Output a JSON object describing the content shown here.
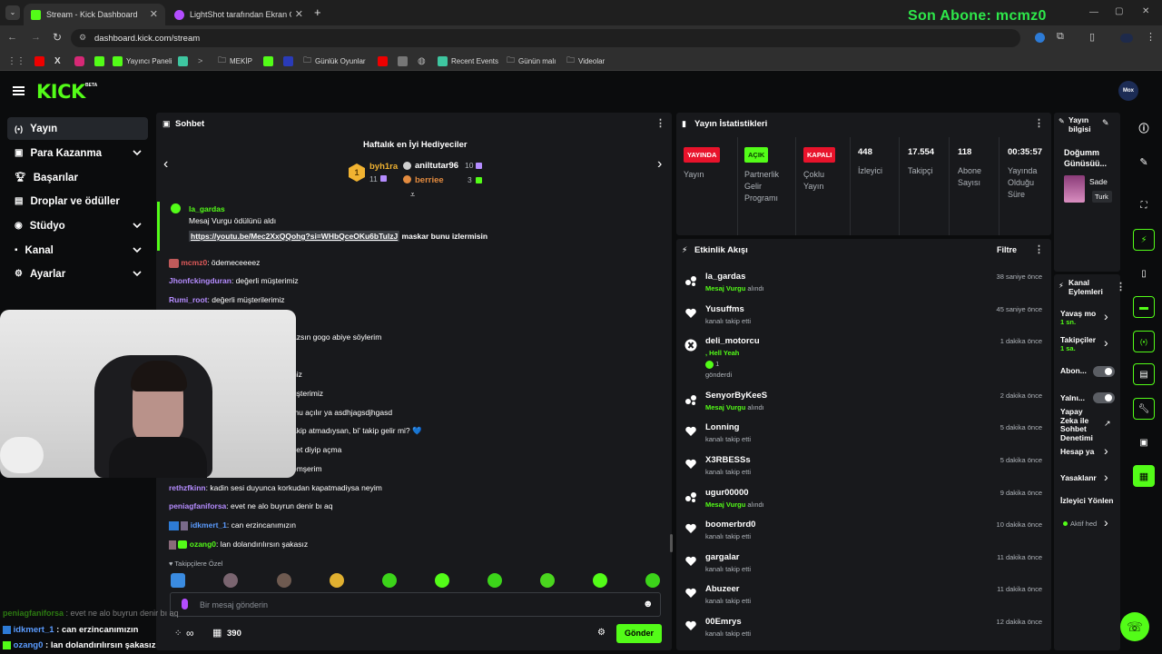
{
  "browser": {
    "tabs": [
      {
        "label": "Stream - Kick Dashboard"
      },
      {
        "label": "LightShot tarafından Ekran Gör"
      }
    ],
    "url": "dashboard.kick.com/stream",
    "bookmarks": [
      "Yayıncı Paneli",
      "MEKİP",
      "Günlük Oyunlar",
      "Recent Events",
      "Günün malı",
      "Videolar"
    ]
  },
  "overlay": {
    "last_sub": "Son Abone: mcmz0"
  },
  "app": {
    "logo": "KICK",
    "logo_tag": "BETA",
    "avatar_text": "Mox"
  },
  "sidebar": {
    "items": [
      {
        "label": "Yayın",
        "icon": "broadcast-icon"
      },
      {
        "label": "Para Kazanma",
        "icon": "wallet-icon"
      },
      {
        "label": "Başarılar",
        "icon": "trophy-icon"
      },
      {
        "label": "Droplar ve ödüller",
        "icon": "gift-icon"
      },
      {
        "label": "Stüdyo",
        "icon": "studio-icon"
      },
      {
        "label": "Kanal",
        "icon": "user-icon"
      },
      {
        "label": "Ayarlar",
        "icon": "gear-icon"
      }
    ]
  },
  "chat": {
    "title": "Sohbet",
    "leaderboard_title": "Haftalık en İyi Hediyeciler",
    "leaders": [
      {
        "rank": "1",
        "name": "byh1ra",
        "count": "11"
      },
      {
        "name": "aniltutar96",
        "count": "10"
      },
      {
        "name": "berriee",
        "count": "3"
      }
    ],
    "highlight": {
      "user": "la_gardas",
      "reward": "Mesaj Vurgu ödülünü aldı",
      "link": "https://youtu.be/Mec2XxQQohg?si=WHbQceOKu6bTulzJ",
      "text": " maskar bunu izlermisin"
    },
    "messages": [
      {
        "user": "mcmz0",
        "text": ": ödemeceeeez",
        "color": "#e05a5a"
      },
      {
        "user": "Jhonfckingduran",
        "text": ": değerli müşterimiz",
        "color": "#b58cff"
      },
      {
        "user": "Rumi_root",
        "text": ": değerli müşterilerimiz",
        "color": "#b58cff"
      },
      {
        "user": "",
        "text": "azsın gogo abiye söylerim",
        "color": "#fff"
      },
      {
        "user": "",
        "text": "niz",
        "color": "#fff"
      },
      {
        "user": "",
        "text": "üşterimiz",
        "color": "#fff"
      },
      {
        "user": "",
        "text": "mu açılır ya asdhjagsdjhgasd",
        "color": "#fff"
      },
      {
        "user": "",
        "text": "akip atmadıysan, bi' takip gelir mi? 💙",
        "color": "#fff"
      },
      {
        "user": "",
        "text": "vet diyip açma",
        "color": "#fff"
      },
      {
        "user": "",
        "text": "emşerim",
        "color": "#fff"
      },
      {
        "user": "rethzfkinn",
        "text": ": kadin sesi duyunca korkudan kapatmadiysa neyim",
        "color": "#b58cff"
      },
      {
        "user": "peniagfaniforsa",
        "text": ": evet ne alo buyrun denir bı aq",
        "color": "#b58cff"
      },
      {
        "user": "idkmert_1",
        "text": ": can erzincanımızın",
        "color": "#5b9cff"
      },
      {
        "user": "ozang0",
        "text": ": lan dolandırılırsın şakasız",
        "color": "#53fc18"
      }
    ],
    "emote_label": "Takipçilere Özel",
    "input_placeholder": "Bir mesaj gönderin",
    "infinity": "∞",
    "points": "390",
    "send_label": "Gönder"
  },
  "webcam_chat": [
    {
      "user": "peniagfaniforsa",
      "text": " : evet ne alo buyrun denir bı aq"
    },
    {
      "user": "idkmert_1",
      "text": " : can erzincanımızın"
    },
    {
      "user": "ozang0",
      "text": " : lan dolandırılırsın şakasız"
    }
  ],
  "stats": {
    "title": "Yayın İstatistikleri",
    "items": [
      {
        "badge": "YAYINDA",
        "label": "Yayın"
      },
      {
        "badge": "AÇIK",
        "label": "Partnerlik Gelir Programı"
      },
      {
        "badge": "KAPALI",
        "label": "Çoklu Yayın"
      },
      {
        "value": "448",
        "label": "İzleyici"
      },
      {
        "value": "17.554",
        "label": "Takipçi"
      },
      {
        "value": "118",
        "label": "Abone Sayısı"
      },
      {
        "value": "00:35:57",
        "label": "Yayında Olduğu Süre"
      }
    ]
  },
  "activity": {
    "title": "Etkinlik Akışı",
    "filter_label": "Filtre",
    "items": [
      {
        "name": "la_gardas",
        "sub_green": "Mesaj Vurgu",
        "sub": " alındı",
        "time": "38 saniye önce",
        "icon": "points-icon"
      },
      {
        "name": "Yusuffms",
        "sub_green": "",
        "sub": "kanalı takip etti",
        "time": "45 saniye önce",
        "icon": "heart-icon"
      },
      {
        "name": "deli_motorcu",
        "sub_green": ", Hell Yeah",
        "sub": "gönderdi",
        "time": "1 dakika önce",
        "icon": "kick-icon",
        "extra": "1"
      },
      {
        "name": "SenyorByKeeS",
        "sub_green": "Mesaj Vurgu",
        "sub": " alındı",
        "time": "2 dakika önce",
        "icon": "points-icon"
      },
      {
        "name": "Lonning",
        "sub_green": "",
        "sub": "kanalı takip etti",
        "time": "5 dakika önce",
        "icon": "heart-icon"
      },
      {
        "name": "X3RBESSs",
        "sub_green": "",
        "sub": "kanalı takip etti",
        "time": "5 dakika önce",
        "icon": "heart-icon"
      },
      {
        "name": "ugur00000",
        "sub_green": "Mesaj Vurgu",
        "sub": " alındı",
        "time": "9 dakika önce",
        "icon": "points-icon"
      },
      {
        "name": "boomerbrd0",
        "sub_green": "",
        "sub": "kanalı takip etti",
        "time": "10 dakika önce",
        "icon": "heart-icon"
      },
      {
        "name": "gargalar",
        "sub_green": "",
        "sub": "kanalı takip etti",
        "time": "11 dakika önce",
        "icon": "heart-icon"
      },
      {
        "name": "Abuzeer",
        "sub_green": "",
        "sub": "kanalı takip etti",
        "time": "11 dakika önce",
        "icon": "heart-icon"
      },
      {
        "name": "00Emrys",
        "sub_green": "",
        "sub": "kanalı takip etti",
        "time": "12 dakika önce",
        "icon": "heart-icon"
      }
    ]
  },
  "stream_info": {
    "title": "Yayın bilgisi",
    "stream_name": "Doğumm Günüsüü...",
    "category": "Sade",
    "language": "Turk"
  },
  "channel_actions": {
    "title": "Kanal Eylemleri",
    "rows": [
      {
        "label": "Yavaş mo",
        "sub": "1 sn."
      },
      {
        "label": "Takipçiler",
        "sub": "1 sa."
      },
      {
        "label": "Abon..."
      },
      {
        "label": "Yalnı..."
      },
      {
        "label": "Yapay Zeka ile Sohbet Denetimi"
      },
      {
        "label": "Hesap ya"
      },
      {
        "label": "Yasaklanr"
      },
      {
        "label": "İzleyici Yönlen"
      },
      {
        "label": "Aktif hed"
      }
    ]
  }
}
